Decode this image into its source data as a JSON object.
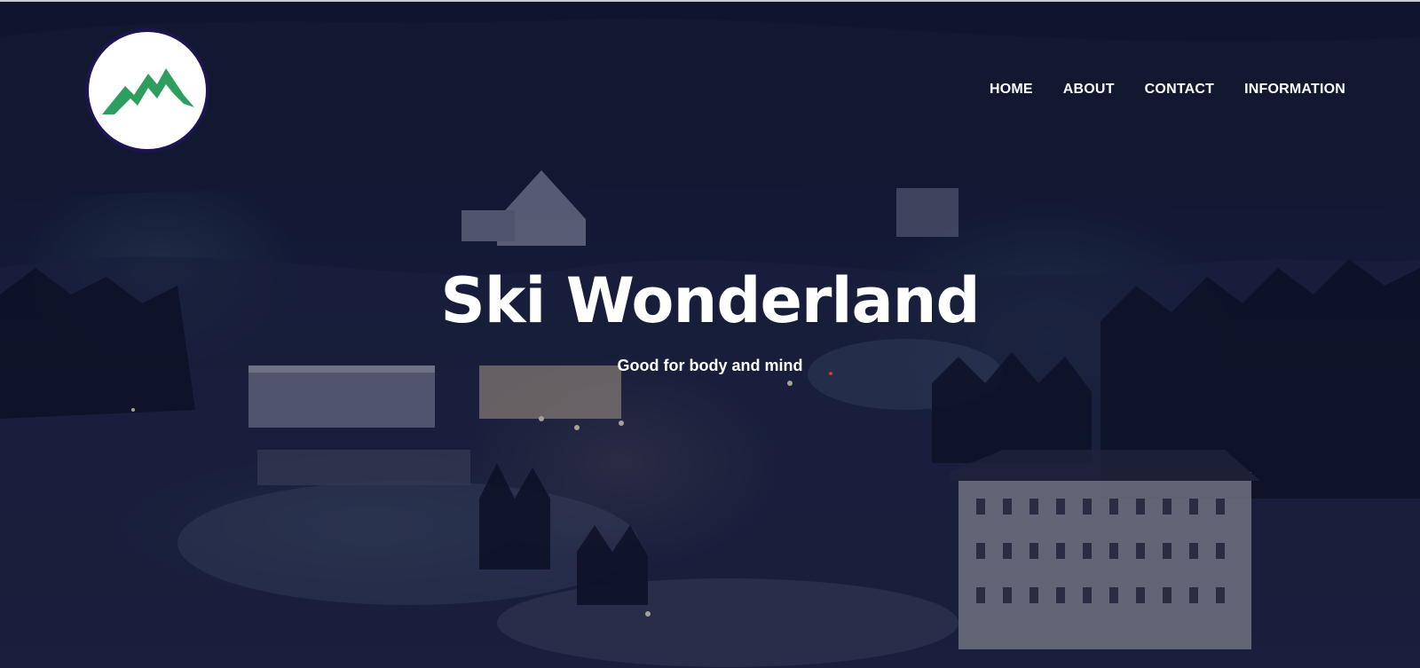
{
  "brand": {
    "logo_icon": "mountain-icon",
    "logo_color": "#2e9e5e"
  },
  "nav": {
    "items": [
      {
        "label": "HOME"
      },
      {
        "label": "ABOUT"
      },
      {
        "label": "CONTACT"
      },
      {
        "label": "INFORMATION"
      }
    ]
  },
  "hero": {
    "title": "Ski Wonderland",
    "subtitle": "Good for body and mind",
    "background": "night-ski-resort-image"
  },
  "colors": {
    "text": "#ffffff",
    "logo_ring": "#1d1450",
    "accent_dot": "#e0342e"
  }
}
